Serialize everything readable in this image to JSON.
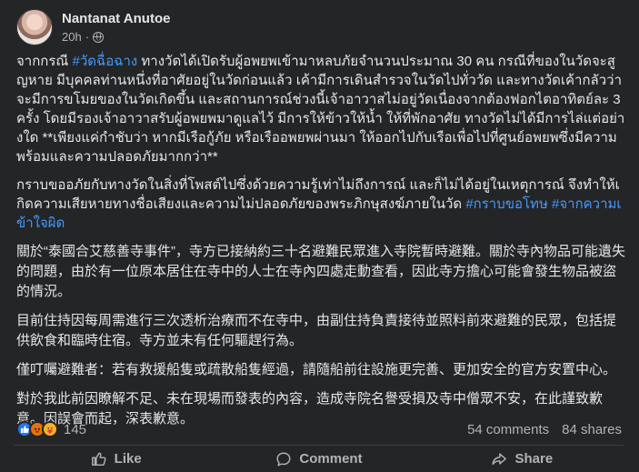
{
  "author": {
    "name": "Nantanat Anutoe",
    "time": "20h",
    "sep": "·"
  },
  "paragraphs": [
    {
      "parts": [
        {
          "text": "จากกรณี ",
          "tag": false
        },
        {
          "text": "#วัดฉื่อฉาง",
          "tag": true
        },
        {
          "text": " ทางวัดได้เปิดรับผู้อพยพเข้ามาหลบภัยจำนวนประมาณ 30 คน กรณีที่ของในวัดจะสูญหาย มีบุคคลท่านหนึ่งที่อาศัยอยู่ในวัดก่อนแล้ว เค้ามีการเดินสำรวจในวัดไปทั่ววัด และทางวัดเค้ากลัวว่าจะมีการขโมยของในวัดเกิดขึ้น และสถานการณ์ช่วงนี้เจ้าอาวาสไม่อยู่วัดเนื่องจากต้องฟอกไตอาทิตย์ละ 3ครั้ง โดยมีรองเจ้าอาวาสรับผู้อพยพมาดูแลไว้ มีการให้ข้าวให้น้ำ ให้ที่พักอาศัย ทางวัดไม่ได้มีการไล่แต่อย่างใด **เพียงแค่กำชับว่า หากมีเรือกู้ภัย หรือเรืออพยพผ่านมา ให้ออกไปกับเรือเพื่อไปที่ศูนย์อพยพซึ่งมีความพร้อมและความปลอดภัยมากกว่า**",
          "tag": false
        }
      ]
    },
    {
      "parts": [
        {
          "text": "กราบขออภัยกับทางวัดในสิ่งที่โพสต์ไปซึ่งด้วยความรู้เท่าไม่ถึงการณ์ และก็ไม่ได้อยู่ในเหตุการณ์ จึงทำให้เกิดความเสียหายทางชื่อเสียงและความไม่ปลอดภัยของพระภิกษุสงฆ์ภายในวัด ",
          "tag": false
        },
        {
          "text": "#กราบขอโทษ",
          "tag": true
        },
        {
          "text": " ",
          "tag": false
        },
        {
          "text": "#จากความเข้าใจผิด",
          "tag": true
        }
      ]
    },
    {
      "parts": [
        {
          "text": "關於“泰國合艾慈善寺事件”，寺方已接納約三十名避難民眾進入寺院暫時避難。關於寺內物品可能遺失的問題，由於有一位原本居住在寺中的人士在寺內四處走動查看，因此寺方擔心可能會發生物品被盜的情況。",
          "tag": false
        }
      ]
    },
    {
      "parts": [
        {
          "text": "目前住持因每周需進行三次透析治療而不在寺中，由副住持負責接待並照料前來避難的民眾，包括提供飲食和臨時住宿。寺方並未有任何驅趕行為。",
          "tag": false
        }
      ]
    },
    {
      "parts": [
        {
          "text": "僅叮囑避難者：若有救援船隻或疏散船隻經過，請隨船前往設施更完善、更加安全的官方安置中心。",
          "tag": false
        }
      ]
    },
    {
      "parts": [
        {
          "text": "對於我此前因瞭解不足、未在現場而發表的內容，造成寺院名譽受損及寺中僧眾不安，在此謹致歉意。因誤會而起，深表歉意。",
          "tag": false
        }
      ]
    }
  ],
  "stats": {
    "reaction_count": "145",
    "comments": "54 comments",
    "shares": "84 shares"
  },
  "reactions": [
    {
      "name": "like",
      "icon": "thumbs-up-icon",
      "color": "#2078f4"
    },
    {
      "name": "angry",
      "icon": "angry-face-icon",
      "color": "#e9710f"
    },
    {
      "name": "care",
      "icon": "care-face-icon",
      "color": "#f7b125"
    }
  ],
  "actions": {
    "like": "Like",
    "comment": "Comment",
    "share": "Share"
  },
  "colors": {
    "background": "#242526",
    "link": "#4599ff",
    "text": "#e4e6eb",
    "muted": "#b0b3b8"
  }
}
